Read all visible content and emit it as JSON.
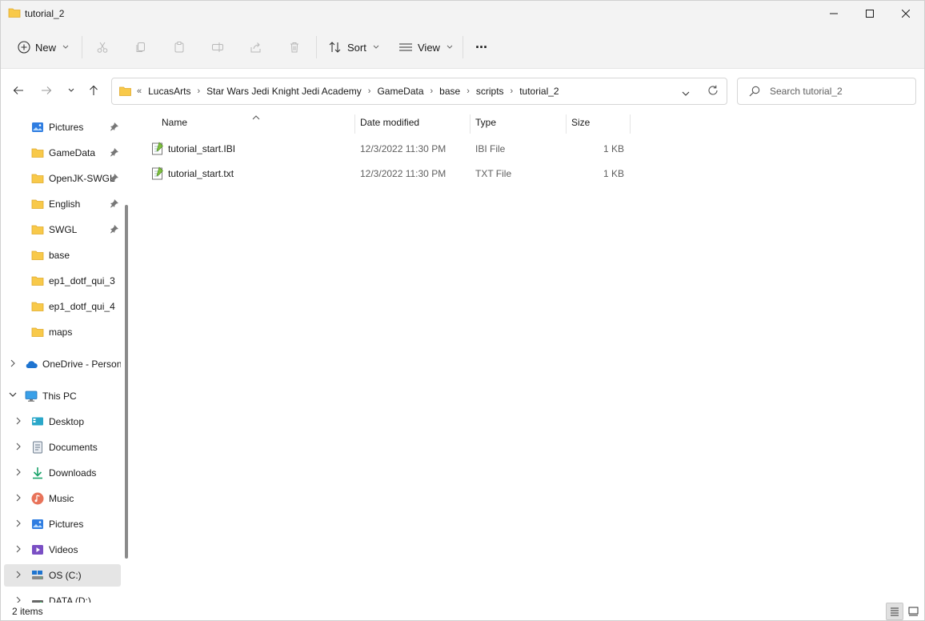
{
  "window": {
    "title": "tutorial_2"
  },
  "commandbar": {
    "new_label": "New",
    "sort_label": "Sort",
    "view_label": "View",
    "more_label": "···"
  },
  "address": {
    "overflow": "«",
    "crumbs": [
      "LucasArts",
      "Star Wars Jedi Knight Jedi Academy",
      "GameData",
      "base",
      "scripts",
      "tutorial_2"
    ]
  },
  "search": {
    "placeholder": "Search tutorial_2"
  },
  "sidebar": {
    "quick_access": [
      {
        "label": "Pictures",
        "pinned": true,
        "icon": "pictures-icon"
      },
      {
        "label": "GameData",
        "pinned": true,
        "icon": "folder-icon"
      },
      {
        "label": "OpenJK-SWGL",
        "pinned": true,
        "icon": "folder-icon"
      },
      {
        "label": "English",
        "pinned": true,
        "icon": "folder-icon"
      },
      {
        "label": "SWGL",
        "pinned": true,
        "icon": "folder-icon"
      },
      {
        "label": "base",
        "pinned": false,
        "icon": "folder-icon"
      },
      {
        "label": "ep1_dotf_qui_3",
        "pinned": false,
        "icon": "folder-icon"
      },
      {
        "label": "ep1_dotf_qui_4",
        "pinned": false,
        "icon": "folder-icon"
      },
      {
        "label": "maps",
        "pinned": false,
        "icon": "folder-icon"
      }
    ],
    "onedrive": "OneDrive - Persona",
    "this_pc": "This PC",
    "pc_items": [
      {
        "label": "Desktop",
        "icon": "desktop-icon"
      },
      {
        "label": "Documents",
        "icon": "documents-icon"
      },
      {
        "label": "Downloads",
        "icon": "downloads-icon"
      },
      {
        "label": "Music",
        "icon": "music-icon"
      },
      {
        "label": "Pictures",
        "icon": "pictures-icon"
      },
      {
        "label": "Videos",
        "icon": "videos-icon"
      },
      {
        "label": "OS (C:)",
        "icon": "drive-icon",
        "selected": true
      },
      {
        "label": "DATA (D:)",
        "icon": "drive-icon"
      }
    ]
  },
  "columns": {
    "name": "Name",
    "date": "Date modified",
    "type": "Type",
    "size": "Size"
  },
  "files": [
    {
      "name": "tutorial_start.IBI",
      "date": "12/3/2022 11:30 PM",
      "type": "IBI File",
      "size": "1 KB"
    },
    {
      "name": "tutorial_start.txt",
      "date": "12/3/2022 11:30 PM",
      "type": "TXT File",
      "size": "1 KB"
    }
  ],
  "status": {
    "count": "2 items"
  },
  "colors": {
    "folder": "#f8c94a",
    "accent": "#0067c0",
    "chrome": "#f3f3f3"
  }
}
